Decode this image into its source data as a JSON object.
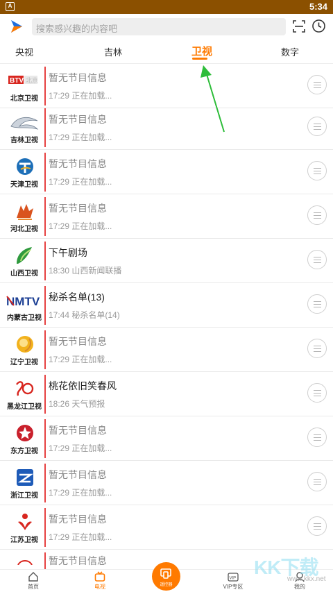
{
  "status_bar": {
    "notif_glyph": "A",
    "time": "5:34"
  },
  "header": {
    "search_placeholder": "搜索感兴趣的内容吧"
  },
  "tabs": [
    {
      "label": "央视",
      "active": false
    },
    {
      "label": "吉林",
      "active": false
    },
    {
      "label": "卫视",
      "active": true
    },
    {
      "label": "数字",
      "active": false
    }
  ],
  "channels": [
    {
      "logo_text": "BTV",
      "logo_sub": "北京",
      "name": "北京卫视",
      "program": "暂无节目信息",
      "next": "17:29  正在加载...",
      "dim": true,
      "icon": "btv-logo-icon"
    },
    {
      "name": "吉林卫视",
      "program": "暂无节目信息",
      "next": "17:29  正在加载...",
      "dim": true,
      "icon": "jilin-logo-icon"
    },
    {
      "name": "天津卫视",
      "program": "暂无节目信息",
      "next": "17:29  正在加载...",
      "dim": true,
      "icon": "tianjin-logo-icon"
    },
    {
      "name": "河北卫视",
      "program": "暂无节目信息",
      "next": "17:29  正在加载...",
      "dim": true,
      "icon": "hebei-logo-icon"
    },
    {
      "name": "山西卫视",
      "program": "下午剧场",
      "next": "18:30  山西新闻联播",
      "dim": false,
      "icon": "shanxi-logo-icon"
    },
    {
      "logo_text": "NMTV",
      "name": "内蒙古卫视",
      "program": "秘杀名单(13)",
      "next": "17:44  秘杀名单(14)",
      "dim": false,
      "icon": "nmtv-logo-icon"
    },
    {
      "name": "辽宁卫视",
      "program": "暂无节目信息",
      "next": "17:29  正在加载...",
      "dim": true,
      "icon": "liaoning-logo-icon"
    },
    {
      "name": "黑龙江卫视",
      "program": "桃花依旧笑春风",
      "next": "18:26  天气预报",
      "dim": false,
      "icon": "heilongjiang-logo-icon"
    },
    {
      "name": "东方卫视",
      "program": "暂无节目信息",
      "next": "17:29  正在加载...",
      "dim": true,
      "icon": "dongfang-logo-icon"
    },
    {
      "name": "浙江卫视",
      "program": "暂无节目信息",
      "next": "17:29  正在加载...",
      "dim": true,
      "icon": "zhejiang-logo-icon"
    },
    {
      "name": "江苏卫视",
      "program": "暂无节目信息",
      "next": "17:29  正在加载...",
      "dim": true,
      "icon": "jiangsu-logo-icon"
    },
    {
      "name": "",
      "program": "暂无节目信息",
      "next": "",
      "dim": true,
      "icon": "partial-logo-icon"
    }
  ],
  "bottom_nav": [
    {
      "label": "首页",
      "icon": "home-icon",
      "active": false
    },
    {
      "label": "电视",
      "icon": "tv-icon",
      "active": true
    },
    {
      "label": "遥控器",
      "icon": "remote-icon",
      "active": false
    },
    {
      "label": "VIP专区",
      "icon": "vip-icon",
      "active": false
    },
    {
      "label": "我的",
      "icon": "profile-icon",
      "active": false
    }
  ],
  "watermark": {
    "text": "KK下载",
    "url_text": "www.kkx.net"
  },
  "colors": {
    "accent": "#ff7a00",
    "status_bar": "#8b5000",
    "divider": "#e64141",
    "annotation_arrow": "#2ebd3a"
  }
}
